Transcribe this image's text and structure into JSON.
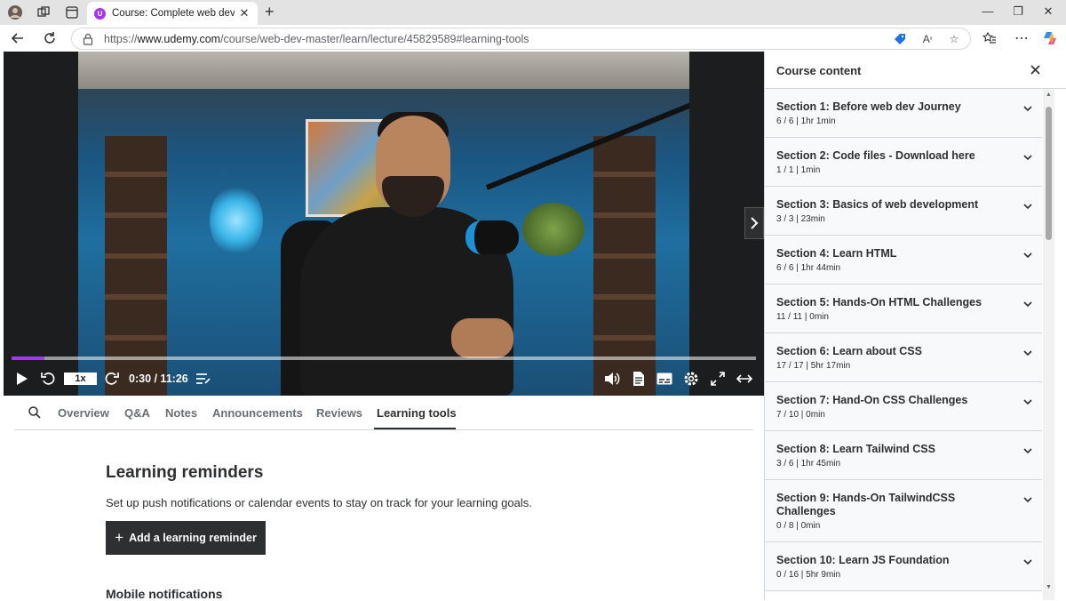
{
  "browser": {
    "tab_title": "Course: Complete web developm",
    "url_prefix": "https://",
    "url_host": "www.udemy.com",
    "url_path": "/course/web-dev-master/learn/lecture/45829589#learning-tools",
    "icons": [
      "avatar-icon",
      "workspaces-icon",
      "tab-actions-icon",
      "udemy-favicon-icon",
      "close-icon",
      "new-tab-icon",
      "minimize-icon",
      "maximize-icon",
      "window-close-icon",
      "back-icon",
      "refresh-icon",
      "lock-icon",
      "coupon-icon",
      "read-aloud-icon",
      "favorite-icon",
      "favorites-icon",
      "menu-icon",
      "copilot-icon"
    ]
  },
  "player": {
    "speed": "1x",
    "time": "0:30 / 11:26",
    "progress": 0.044,
    "accent": "#a435f0",
    "icons": [
      "play-icon",
      "rewind-icon",
      "forward-icon",
      "playlist-icon",
      "volume-icon",
      "transcript-icon",
      "captions-icon",
      "settings-icon",
      "fullscreen-icon",
      "expand-icon",
      "next-chevron-icon"
    ]
  },
  "nav": {
    "tabs": [
      "Overview",
      "Q&A",
      "Notes",
      "Announcements",
      "Reviews",
      "Learning tools"
    ],
    "active": "Learning tools"
  },
  "main": {
    "heading": "Learning reminders",
    "description": "Set up push notifications or calendar events to stay on track for your learning goals.",
    "button_label": "Add a learning reminder",
    "button_icon": "+",
    "next_heading": "Mobile notifications"
  },
  "sidebar": {
    "title": "Course content",
    "sections": [
      {
        "title": "Section 1: Before web dev Journey",
        "meta": "6 / 6 | 1hr 1min"
      },
      {
        "title": "Section 2: Code files - Download here",
        "meta": "1 / 1 | 1min"
      },
      {
        "title": "Section 3: Basics of web development",
        "meta": "3 / 3 | 23min"
      },
      {
        "title": "Section 4: Learn HTML",
        "meta": "6 / 6 | 1hr 44min"
      },
      {
        "title": "Section 5: Hands-On HTML Challenges",
        "meta": "11 / 11 | 0min"
      },
      {
        "title": "Section 6: Learn about CSS",
        "meta": "17 / 17 | 5hr 17min"
      },
      {
        "title": "Section 7: Hand-On CSS Challenges",
        "meta": "7 / 10 | 0min"
      },
      {
        "title": "Section 8: Learn Tailwind CSS",
        "meta": "3 / 6 | 1hr 45min"
      },
      {
        "title": "Section 9: Hands-On TailwindCSS Challenges",
        "meta": "0 / 8 | 0min"
      },
      {
        "title": "Section 10: Learn JS Foundation",
        "meta": "0 / 16 | 5hr 9min"
      }
    ]
  }
}
